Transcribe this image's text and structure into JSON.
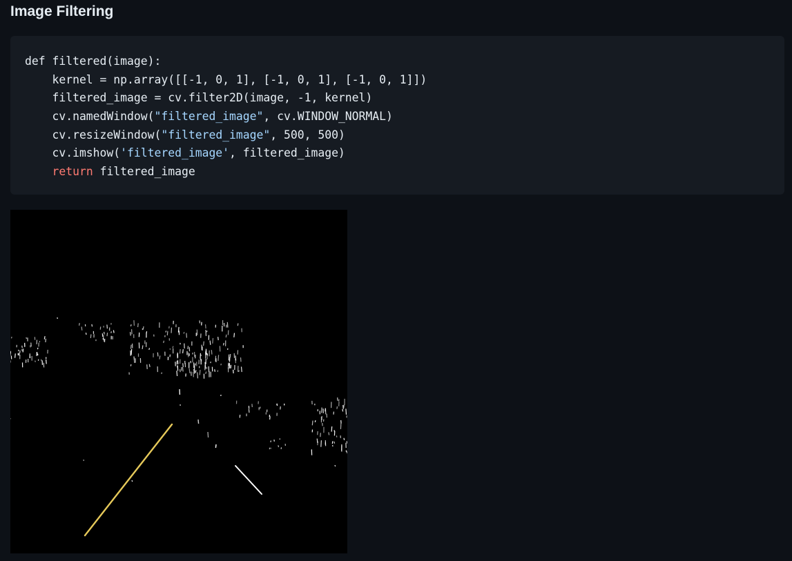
{
  "page": {
    "heading": "Image Filtering"
  },
  "code_block": {
    "lines": [
      [
        {
          "text": "def filtered(image):",
          "type": "plain"
        }
      ],
      [
        {
          "text": "    kernel = np.array([[-1, 0, 1], [-1, 0, 1], [-1, 0, 1]])",
          "type": "plain"
        }
      ],
      [
        {
          "text": "    filtered_image = cv.filter2D(image, -1, kernel)",
          "type": "plain"
        }
      ],
      [
        {
          "text": "    cv.namedWindow(",
          "type": "plain"
        },
        {
          "text": "\"filtered_image\"",
          "type": "str"
        },
        {
          "text": ", cv.WINDOW_NORMAL)",
          "type": "plain"
        }
      ],
      [
        {
          "text": "    cv.resizeWindow(",
          "type": "plain"
        },
        {
          "text": "\"filtered_image\"",
          "type": "str"
        },
        {
          "text": ", 500, 500)",
          "type": "plain"
        }
      ],
      [
        {
          "text": "    cv.imshow(",
          "type": "plain"
        },
        {
          "text": "'filtered_image'",
          "type": "str"
        },
        {
          "text": ", filtered_image)",
          "type": "plain"
        }
      ],
      [
        {
          "text": "    ",
          "type": "plain"
        },
        {
          "text": "return",
          "type": "kw"
        },
        {
          "text": " filtered_image",
          "type": "plain"
        }
      ]
    ]
  },
  "output_image": {
    "background": "#000000",
    "edge_color": "#ffffff",
    "lane_color": "#e6c95a"
  }
}
